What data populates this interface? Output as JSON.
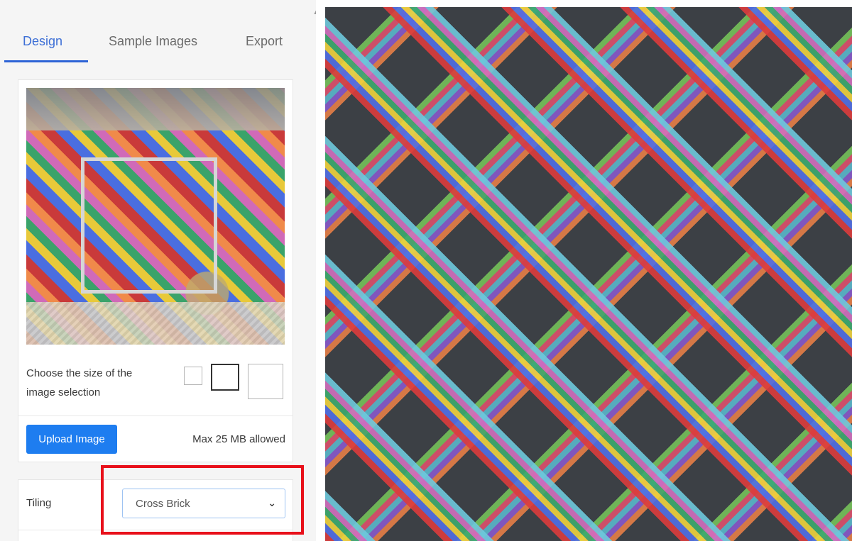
{
  "tabs": [
    {
      "label": "Design",
      "active": true
    },
    {
      "label": "Sample Images",
      "active": false
    },
    {
      "label": "Export",
      "active": false
    }
  ],
  "image_panel": {
    "size_label": "Choose the size of the image selection",
    "size_options": [
      "small",
      "medium",
      "large"
    ],
    "selected_size": "medium"
  },
  "upload": {
    "button_label": "Upload Image",
    "max_note": "Max 25 MB allowed"
  },
  "tiling": {
    "label": "Tiling",
    "selected": "Cross Brick"
  },
  "colors": {
    "accent": "#2d63d6",
    "button": "#1e7df0",
    "highlight": "#e8101a",
    "pattern_background": "#3c4045"
  }
}
